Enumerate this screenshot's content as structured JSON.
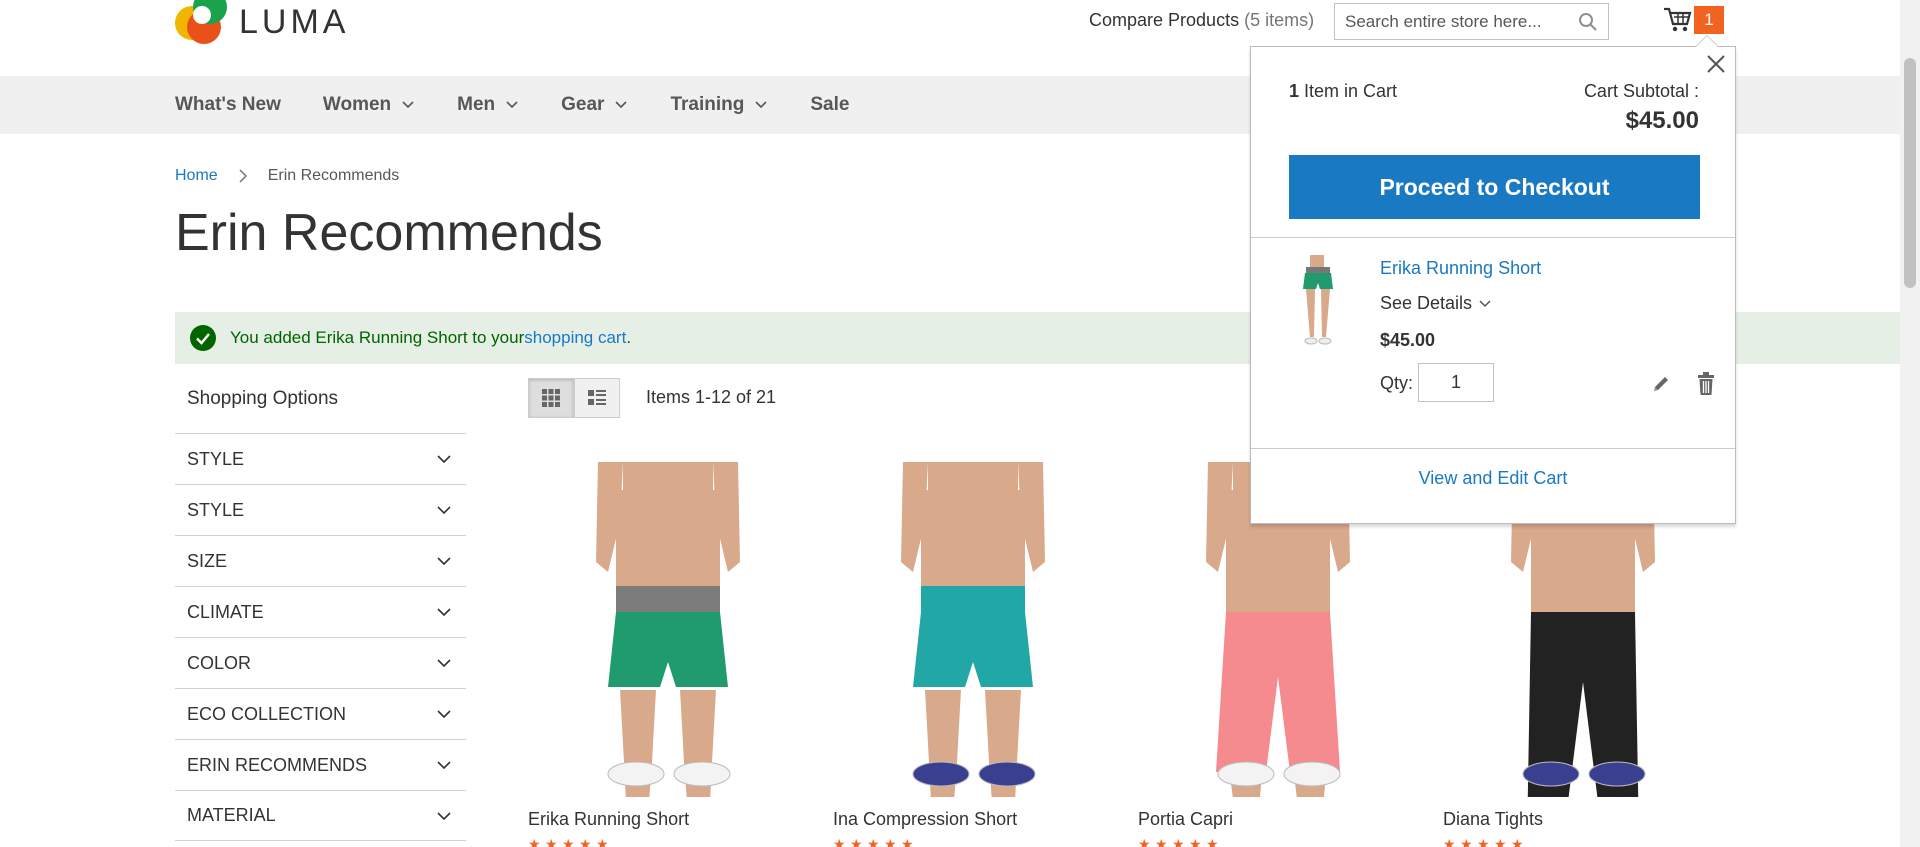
{
  "header": {
    "logo_text": "LUMA",
    "compare_label": "Compare Products",
    "compare_count": "(5 items)",
    "search_placeholder": "Search entire store here...",
    "cart_count": "1"
  },
  "nav": {
    "items": [
      {
        "label": "What's New",
        "dropdown": false
      },
      {
        "label": "Women",
        "dropdown": true
      },
      {
        "label": "Men",
        "dropdown": true
      },
      {
        "label": "Gear",
        "dropdown": true
      },
      {
        "label": "Training",
        "dropdown": true
      },
      {
        "label": "Sale",
        "dropdown": false
      }
    ]
  },
  "breadcrumb": {
    "home": "Home",
    "current": "Erin Recommends"
  },
  "page_title": "Erin Recommends",
  "message": {
    "prefix": "You added Erika Running Short to your ",
    "link": "shopping cart",
    "suffix": "."
  },
  "sidebar": {
    "title": "Shopping Options",
    "filters": [
      "STYLE",
      "STYLE",
      "SIZE",
      "CLIMATE",
      "COLOR",
      "ECO COLLECTION",
      "ERIN RECOMMENDS",
      "MATERIAL"
    ]
  },
  "toolbar": {
    "items_count": "Items 1-12 of 21"
  },
  "products": [
    {
      "name": "Erika Running Short",
      "garment_color": "#1f9b6e",
      "garment_type": "shorts"
    },
    {
      "name": "Ina Compression Short",
      "garment_color": "#22a7a7",
      "garment_type": "shorts"
    },
    {
      "name": "Portia Capri",
      "garment_color": "#f58a8f",
      "garment_type": "capri"
    },
    {
      "name": "Diana Tights",
      "garment_color": "#222222",
      "garment_type": "tights"
    }
  ],
  "minicart": {
    "items_count": "1",
    "items_label": "Item in Cart",
    "subtotal_label": "Cart Subtotal :",
    "subtotal": "$45.00",
    "checkout_label": "Proceed to Checkout",
    "item": {
      "name": "Erika Running Short",
      "details_label": "See Details",
      "price": "$45.00",
      "qty_label": "Qty:",
      "qty": "1"
    },
    "view_cart_label": "View and Edit Cart"
  },
  "colors": {
    "link": "#1979c3",
    "accent": "#f26322",
    "success": "#006400"
  }
}
